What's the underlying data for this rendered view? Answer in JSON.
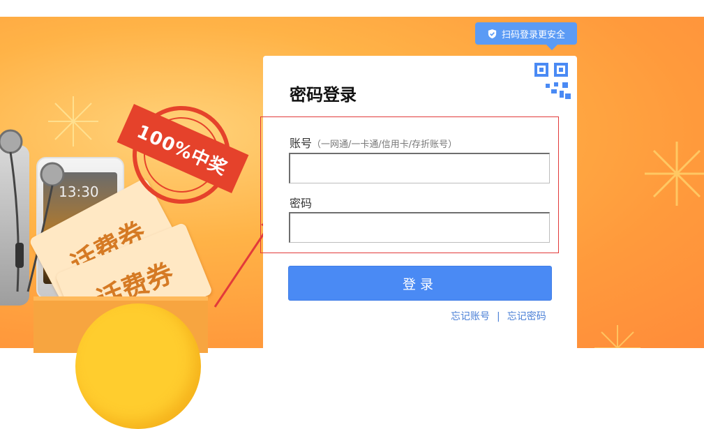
{
  "banner": {
    "stamp_text": "100%中奖",
    "ticket_text_1": "话费券",
    "ticket_text_2": "话费券",
    "phone_time": "13:30"
  },
  "tip": {
    "text": "扫码登录更安全",
    "icon": "shield-check-icon"
  },
  "login": {
    "title": "密码登录",
    "account_label": "账号",
    "account_hint": "（一网通/一卡通/信用卡/存折账号）",
    "account_value": "",
    "password_label": "密码",
    "password_value": "",
    "submit_label": "登录",
    "forgot_account": "忘记账号",
    "separator": "|",
    "forgot_password": "忘记密码"
  },
  "colors": {
    "primary": "#4a8af4",
    "banner": "#ff9a3c",
    "highlight": "#e23a3a",
    "tip": "#5b9bf5"
  }
}
